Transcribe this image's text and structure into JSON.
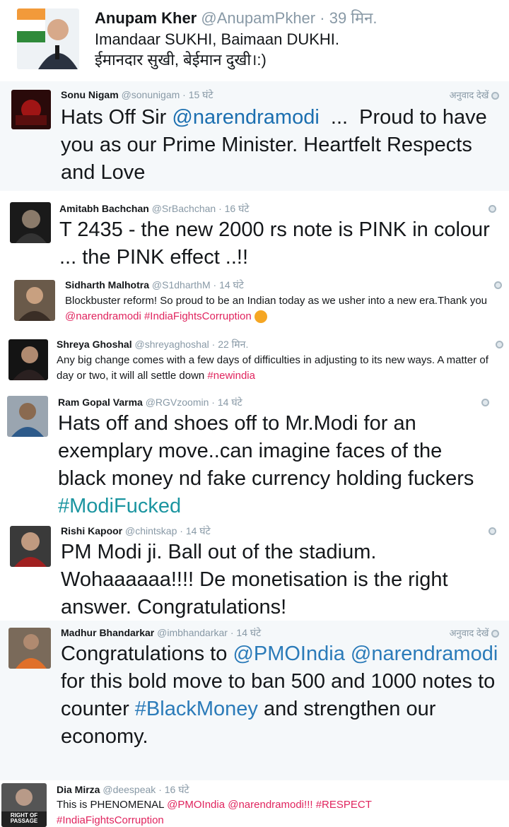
{
  "tweets": [
    {
      "name": "Anupam Kher",
      "handle": "@AnupamPkher",
      "time": "39 मिन.",
      "line1": "Imandaar SUKHI, Baimaan DUKHI.",
      "line2": "ईमानदार सुखी, बेईमान दुखी।:)"
    },
    {
      "name": "Sonu Nigam",
      "handle": "@sonunigam",
      "time": "15 घंटे",
      "translate": "अनुवाद देखें",
      "text_a": "Hats Off Sir ",
      "mention": "@narendramodi",
      "text_b": "  ...  Proud to have you as our Prime Minister. Heartfelt Respects and Love"
    },
    {
      "name": "Amitabh Bachchan",
      "handle": "@SrBachchan",
      "time": "16 घंटे",
      "text": "T 2435 - the new 2000 rs note is PINK in colour ... the PINK effect ..!!"
    },
    {
      "name": "Sidharth Malhotra",
      "handle": "@S1dharthM",
      "time": "14 घंटे",
      "text_a": "Blockbuster reform! So proud to be an Indian today as we usher into a new era.Thank you ",
      "mention": "@narendramodi",
      "hashtag": "#IndiaFightsCorruption"
    },
    {
      "name": "Shreya Ghoshal",
      "handle": "@shreyaghoshal",
      "time": "22 मिन.",
      "text_a": "Any big change comes with a few days of difficulties in adjusting to its new ways. A matter of day or two, it will all settle down ",
      "hashtag": "#newindia"
    },
    {
      "name": "Ram Gopal Varma",
      "handle": "@RGVzoomin",
      "time": "14 घंटे",
      "text_a": "Hats off and shoes off to Mr.Modi for an exemplary move..can imagine faces of the black money nd fake currency holding fuckers ",
      "hashtag": "#ModiFucked"
    },
    {
      "name": "Rishi Kapoor",
      "handle": "@chintskap",
      "time": "14 घंटे",
      "text": "PM Modi ji. Ball out of the stadium. Wohaaaaaa!!!! De monetisation is the right answer. Congratulations!"
    },
    {
      "name": "Madhur Bhandarkar",
      "handle": "@imbhandarkar",
      "time": "14 घंटे",
      "translate": "अनुवाद देखें",
      "text_a": "Congratulations to ",
      "mention1": "@PMOIndia",
      "mention2": "@narendramodi",
      "text_b": " for this bold move to ban 500 and 1000 notes to counter ",
      "hashtag": "#BlackMoney",
      "text_c": " and strengthen our economy."
    },
    {
      "name": "Dia Mirza",
      "handle": "@deespeak",
      "time": "16 घंटे",
      "text_a": "This is PHENOMENAL ",
      "mention1": "@PMOIndia",
      "mention2": "@narendramodi",
      "exclaim": "!!! ",
      "hashtag1": "#RESPECT",
      "hashtag2": "#IndiaFightsCorruption",
      "avatar_caption": "RIGHT OF PASSAGE"
    }
  ],
  "colors": {
    "name": "#14171a",
    "meta": "#8899a6",
    "link_red": "#e0245e",
    "link_teal": "#1b95a0",
    "link_blue": "#2b7bb9",
    "background_alt": "#f5f8fa"
  }
}
